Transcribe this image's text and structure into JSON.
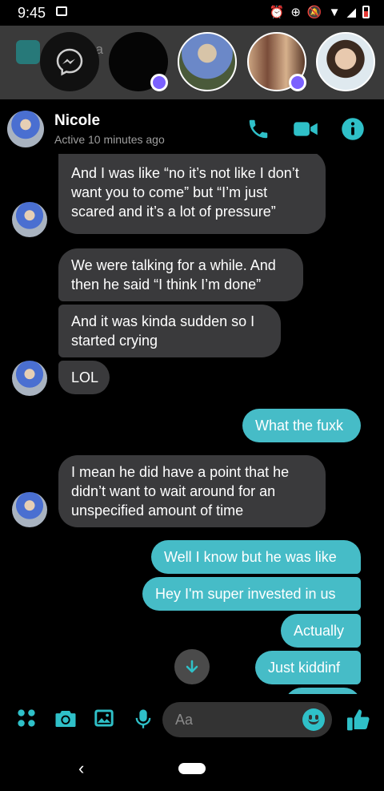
{
  "status_bar": {
    "time": "9:45"
  },
  "background_app": {
    "search_partial": "ea"
  },
  "header": {
    "name": "Nicole",
    "status": "Active 10 minutes ago"
  },
  "messages": [
    {
      "from": "Nicole",
      "text": "And I was like “no it’s not like I don’t want you to come” but “I’m just scared and it’s a lot of pressure”"
    },
    {
      "from": "Nicole",
      "text": "We were talking for a while. And then he said “I think I’m done”"
    },
    {
      "from": "Nicole",
      "text": "And it was kinda sudden so I started crying"
    },
    {
      "from": "Nicole",
      "text": "LOL"
    },
    {
      "from": "me",
      "text": "What the fuxk"
    },
    {
      "from": "Nicole",
      "text": "I mean he did have a point that he didn’t want to wait around for an unspecified amount of time"
    },
    {
      "from": "me",
      "text": "Well I know but he was like"
    },
    {
      "from": "me",
      "text": "Hey I'm super invested in us"
    },
    {
      "from": "me",
      "text": "Actually"
    },
    {
      "from": "me",
      "text": "Just kiddinf"
    }
  ],
  "composer": {
    "placeholder": "Aa"
  },
  "colors": {
    "accent": "#2fc0c8",
    "outgoing_bubble": "#46bcc7",
    "incoming_bubble": "#3a3a3c",
    "background": "#000000"
  }
}
